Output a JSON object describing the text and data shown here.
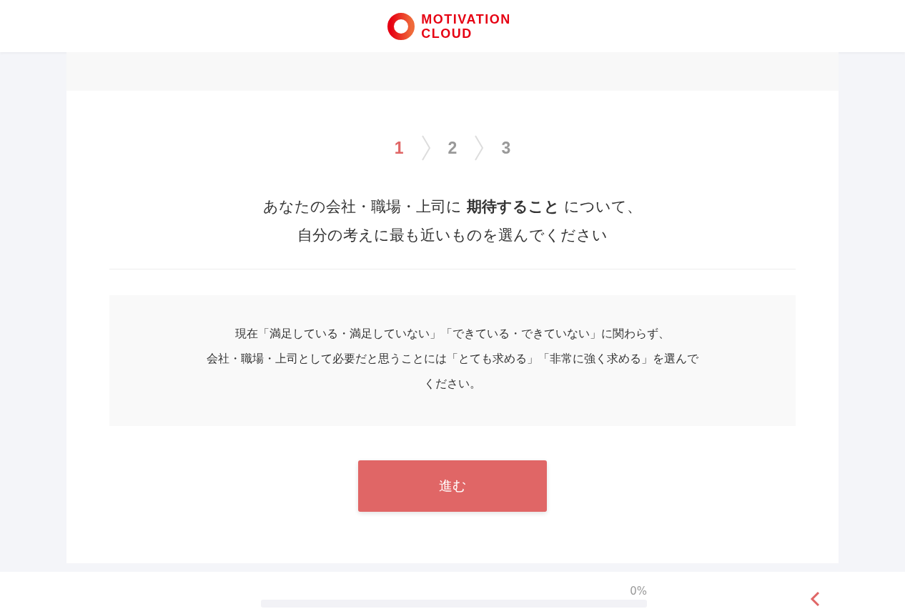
{
  "header": {
    "logo_lines": [
      "MOTIVATION",
      "CLOUD"
    ]
  },
  "steps": [
    {
      "label": "1",
      "selected": true
    },
    {
      "label": "2",
      "selected": false
    },
    {
      "label": "3",
      "selected": false
    }
  ],
  "question": [
    "あなたの会社・職場・上司に **期待すること** について、",
    "自分の考えに最も近いものを選んでください"
  ],
  "note": [
    "現在「満足している・満足していない」「できている・できていない」に関わらず、",
    "会社・職場・上司として必要だと思うことには「とても求める」「非常に強く求める」を選んで",
    "ください。"
  ],
  "next_button": "進む",
  "progress": {
    "level": 0,
    "reading": "0%"
  }
}
